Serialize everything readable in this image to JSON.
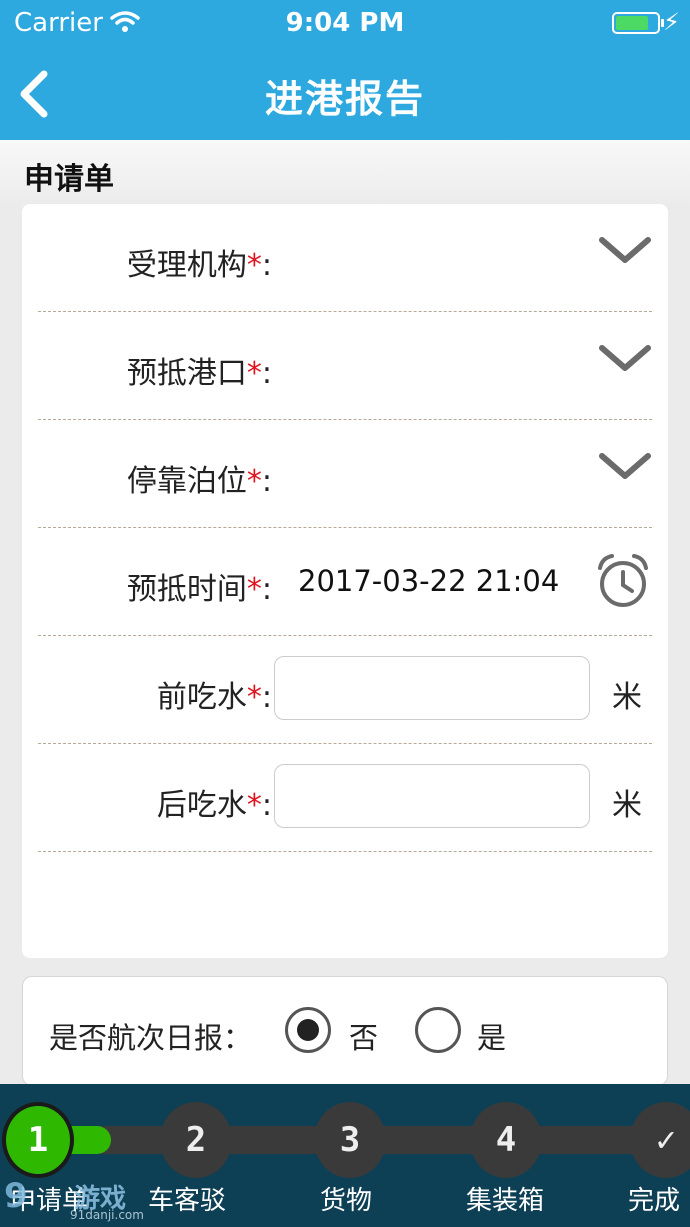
{
  "status_bar": {
    "carrier": "Carrier",
    "time": "9:04 PM"
  },
  "nav": {
    "title": "进港报告"
  },
  "section": {
    "title": "申请单"
  },
  "form": {
    "rows": [
      {
        "label": "受理机构",
        "required_mark": "*",
        "colon": ":",
        "control": "dropdown"
      },
      {
        "label": "预抵港口",
        "required_mark": "*",
        "colon": ":",
        "control": "dropdown"
      },
      {
        "label": "停靠泊位",
        "required_mark": "*",
        "colon": ":",
        "control": "dropdown"
      },
      {
        "label": "预抵时间",
        "required_mark": "*",
        "colon": ":",
        "control": "datetime",
        "value": "2017-03-22 21:04"
      },
      {
        "label": "前吃水",
        "required_mark": "*",
        "colon": ":",
        "control": "input",
        "value": "",
        "unit": "米"
      },
      {
        "label": "后吃水",
        "required_mark": "*",
        "colon": ":",
        "control": "input",
        "value": "",
        "unit": "米"
      }
    ]
  },
  "voyage_report": {
    "question": "是否航次日报：",
    "options": [
      {
        "label": "否",
        "selected": true
      },
      {
        "label": "是",
        "selected": false
      }
    ]
  },
  "steps": {
    "progress_fraction": 0.14,
    "items": [
      {
        "number": "1",
        "label": "申请单",
        "active": true
      },
      {
        "number": "2",
        "label": "车客驳",
        "active": false
      },
      {
        "number": "3",
        "label": "货物",
        "active": false
      },
      {
        "number": "4",
        "label": "集装箱",
        "active": false
      },
      {
        "number": "✓",
        "label": "完成",
        "active": false
      }
    ]
  },
  "watermark": {
    "mark": "9",
    "text": "游戏",
    "site": "91danji.com"
  },
  "colors": {
    "nav_blue": "#2ea9e0",
    "required_red": "#e0141e",
    "progress_green": "#2fb800",
    "bottom_bar": "#0d3f55"
  },
  "icons": {
    "back": "chevron-left-icon",
    "dropdown": "chevron-down-icon",
    "datetime": "alarm-clock-icon",
    "wifi": "wifi-icon",
    "battery": "battery-icon",
    "charging": "bolt-icon",
    "done_step": "checkmark-icon"
  }
}
